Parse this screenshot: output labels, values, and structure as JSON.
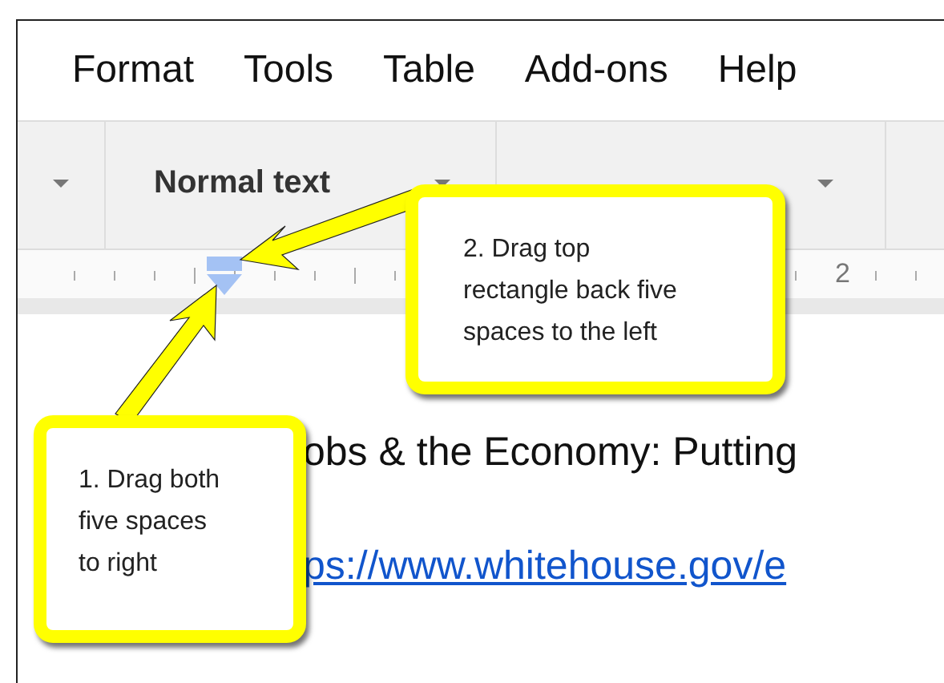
{
  "menu": [
    {
      "label": "Format"
    },
    {
      "label": "Tools"
    },
    {
      "label": "Table"
    },
    {
      "label": "Add-ons"
    },
    {
      "label": "Help"
    }
  ],
  "toolbar": {
    "style_select": {
      "value": "Normal text"
    }
  },
  "ruler": {
    "number": "2"
  },
  "document": {
    "heading": "obs & the Economy: Putting",
    "link": "ps://www.whitehouse.gov/e"
  },
  "callouts": [
    {
      "text": "1. Drag both\nfive spaces\nto right"
    },
    {
      "text": "2. Drag top\nrectangle back five\nspaces to the left"
    }
  ]
}
